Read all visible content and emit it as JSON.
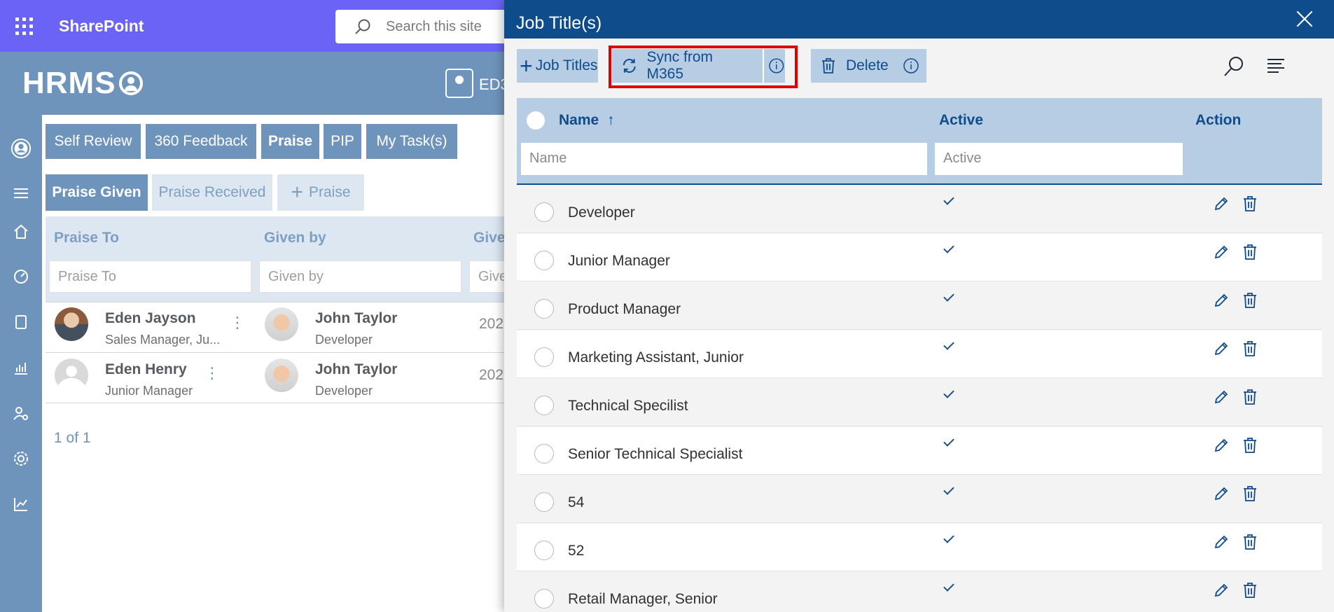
{
  "sharepoint": {
    "brand": "SharePoint",
    "search_placeholder": "Search this site",
    "app_logo": "HRMS",
    "user_badge_text": "ED3"
  },
  "main_tabs": [
    {
      "label": "Self Review"
    },
    {
      "label": "360 Feedback"
    },
    {
      "label": "Praise"
    },
    {
      "label": "PIP"
    },
    {
      "label": "My Task(s)"
    }
  ],
  "praise_tabs": {
    "given": "Praise Given",
    "received": "Praise Received",
    "add": "Praise"
  },
  "praise_table": {
    "columns": [
      "Praise To",
      "Given by",
      "Give"
    ],
    "filters": [
      "Praise To",
      "Given by",
      "Give"
    ],
    "rows": [
      {
        "to_name": "Eden Jayson",
        "to_sub": "Sales Manager, Ju...",
        "by_name": "John Taylor",
        "by_sub": "Developer",
        "date": "202"
      },
      {
        "to_name": "Eden Henry",
        "to_sub": "Junior Manager",
        "by_name": "John Taylor",
        "by_sub": "Developer",
        "date": "202"
      }
    ],
    "pager": "1 of 1"
  },
  "panel": {
    "title": "Job Title(s)",
    "add_button": "Job Titles",
    "sync_button": "Sync from M365",
    "delete_button": "Delete",
    "columns": {
      "name": "Name",
      "active": "Active",
      "action": "Action"
    },
    "filters": {
      "name": "Name",
      "active": "Active"
    },
    "rows": [
      {
        "name": "Developer",
        "active": true
      },
      {
        "name": "Junior Manager",
        "active": true
      },
      {
        "name": "Product Manager",
        "active": true
      },
      {
        "name": "Marketing Assistant, Junior",
        "active": true
      },
      {
        "name": "Technical Specilist",
        "active": true
      },
      {
        "name": "Senior Technical Specialist",
        "active": true
      },
      {
        "name": "54",
        "active": true
      },
      {
        "name": "52",
        "active": true
      },
      {
        "name": "Retail Manager, Senior",
        "active": true
      }
    ]
  },
  "colors": {
    "sp_purple": "#6b63f5",
    "hrms_blue": "#6f94bc",
    "panel_header": "#0f4c8c",
    "highlight": "#e00000"
  }
}
